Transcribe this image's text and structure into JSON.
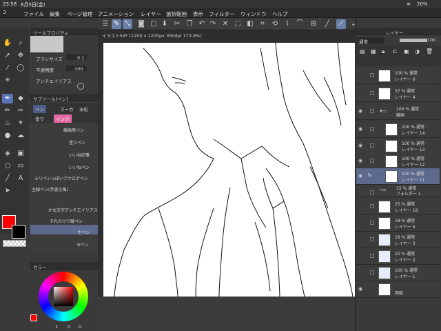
{
  "status": {
    "time": "23:58",
    "date": "6月5日(金)",
    "battery": "20%"
  },
  "menu": [
    "ファイル",
    "編集",
    "ページ管理",
    "アニメーション",
    "レイヤー",
    "選択範囲",
    "表示",
    "フィルター",
    "ウィンドウ",
    "ヘルプ"
  ],
  "tool_property": {
    "title": "ツールプロパティ",
    "brush_size_label": "ブラシサイズ",
    "brush_size_value": "0.1",
    "opacity_label": "不透明度",
    "opacity_value": "100",
    "aa_label": "アンチエイリアス"
  },
  "subtool": {
    "title": "サブツール[ペン]",
    "tabs": [
      "ペン",
      "マーカ",
      "水彩",
      "塗り",
      "インク"
    ],
    "items": [
      "線画用ペン",
      "塗りペン",
      "いいね記事",
      "いいねペン",
      "ミリペンっぽいアナログペン",
      "主線ペン(手書き風)",
      "かな文字アンチエイリアスペン",
      "それだけで線ペン",
      "主ペン",
      "Gペン"
    ]
  },
  "color": {
    "main": "#ff0000",
    "sub": "#000000",
    "tab": "カラー",
    "values": [
      "1",
      "0",
      "0"
    ]
  },
  "doc": {
    "tab": "イラスト54* (1200 x 1200px 350dpi 173.8%)"
  },
  "layers": {
    "title": "レイヤー",
    "blend": "通常",
    "opacity": "100",
    "items": [
      {
        "l1": "100 % 通常",
        "l2": "レイヤー 6"
      },
      {
        "l1": "37 % 通常",
        "l2": "レイヤー 4"
      },
      {
        "l1": "100 % 通常",
        "l2": "線画"
      },
      {
        "l1": "100 % 通常",
        "l2": "レイヤー 14"
      },
      {
        "l1": "100 % 通常",
        "l2": "レイヤー 13"
      },
      {
        "l1": "100 % 通常",
        "l2": "レイヤー 12"
      },
      {
        "l1": "100 % 通常",
        "l2": "レイヤー 11"
      },
      {
        "l1": "15 % 通常",
        "l2": "フォルダー 1"
      },
      {
        "l1": "25 % 通常",
        "l2": "レイヤー 18"
      },
      {
        "l1": "18 % 通常",
        "l2": "レイヤー 5"
      },
      {
        "l1": "18 % 通常",
        "l2": "レイヤー 3"
      },
      {
        "l1": "10 % 通常",
        "l2": "レイヤー 2"
      },
      {
        "l1": "100 % 通常",
        "l2": "レイヤー 1"
      },
      {
        "l1": "",
        "l2": "用紙"
      }
    ]
  }
}
